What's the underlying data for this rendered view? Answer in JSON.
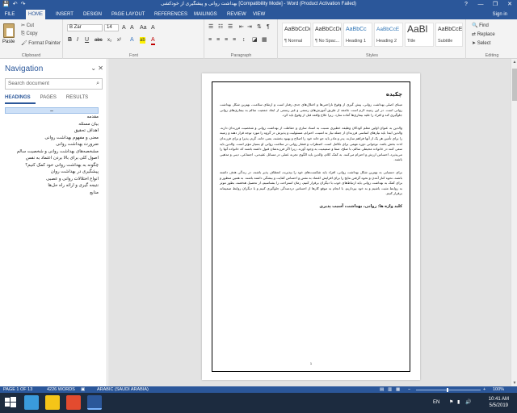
{
  "window": {
    "title": "بهداشت روانی و پیشگیری از خودکشی [Compatibility Mode] - Word (Product Activation Failed)",
    "help": "?",
    "minimize": "—",
    "maximize": "❐",
    "close": "✕"
  },
  "qat": {
    "save": "💾",
    "undo": "↶",
    "redo": "↷"
  },
  "tabs": [
    "FILE",
    "HOME",
    "INSERT",
    "DESIGN",
    "PAGE LAYOUT",
    "REFERENCES",
    "MAILINGS",
    "REVIEW",
    "VIEW"
  ],
  "signin": "Sign in",
  "ribbon": {
    "clipboard": {
      "paste": "Paste",
      "cut": "Cut",
      "copy": "Copy",
      "format_painter": "Format Painter",
      "label": "Clipboard"
    },
    "font": {
      "font_name": "B Zar",
      "font_size": "14",
      "grow": "A",
      "shrink": "A",
      "case": "Aa",
      "clear": "A",
      "bold": "B",
      "italic": "I",
      "underline": "U",
      "strike": "abc",
      "sub": "x₂",
      "sup": "x²",
      "effects": "A",
      "highlight": "ab",
      "color": "A",
      "label": "Font"
    },
    "paragraph": {
      "label": "Paragraph"
    },
    "styles": {
      "label": "Styles",
      "items": [
        {
          "sample": "AaBbCcDc",
          "name": "¶ Normal"
        },
        {
          "sample": "AaBbCcDc",
          "name": "¶ No Spac..."
        },
        {
          "sample": "AaBbCc",
          "name": "Heading 1"
        },
        {
          "sample": "AaBbCcE",
          "name": "Heading 2"
        },
        {
          "sample": "AaBl",
          "name": "Title"
        },
        {
          "sample": "AaBbCcE",
          "name": "Subtitle"
        }
      ]
    },
    "editing": {
      "find": "Find",
      "replace": "Replace",
      "select": "Select",
      "label": "Editing"
    }
  },
  "navigation": {
    "title": "Navigation",
    "search_placeholder": "Search document",
    "tabs": [
      "HEADINGS",
      "PAGES",
      "RESULTS"
    ],
    "selected_heading": "ــ",
    "headings": [
      "مقدمه",
      "بیان مسئله",
      "اهداف تحقیق",
      "معنی و مفهوم بهداشت روانی",
      "ضرورت بهداشت روانی",
      "مشخصه‌های بهداشت روانی و شخصیت سالم",
      "اصول کلی برای بالا بردن اعتماد به نفس",
      "چگونه به بهداشت روانی خود کمک کنیم؟",
      "پیشگیری در بهداشت روان",
      "انواع اختلالات روانی و عصبی",
      "نتیجه گیری و ارائه راه حل‌ها",
      "منابع"
    ]
  },
  "document": {
    "heading": "چکیده",
    "paragraphs": [
      "مبنای اصلی بهداشت روانی، پیش گیری از وقوع ناراحتی‌ها و اختلال‌های جدی رفتار است و ارتقای سلامت، بهترین شکل بهداشت روانی است. در این زمینه لازم است جامعه از طریق آموزش‌های رسمی و غیر رسمی از ابعاد جمعیت سالم به بیماری‌های روانی جلوگیری کند و افراد را علیه بیماری‌ها آماده سازد. زیرا علاج واقعه قبل از وقوع باید کرد.",
      "والدین به عنوان اولین معلم کودکان وظیفه خطیری نسبت به اسناد سازی و حفاظت از بهداشت روانی و شخصیت فرزندان دارند. والدین ابتدا باید نیازهای اساسی فرزندان از جمله نیاز به امنیت، احترام، مسئولیت و پذیرش در گروه را مورد توجه قرار دهند و زمینه را برای تأمین هر یک از آنها فراهم سازند. پدر و مادر باید جو خانه خود را اصلاح و بهبود بخشند، یعنی خانه، گرم، پذیرا و برای فرزندان لذت بخش باشد. نوجوانی دوره مهمی برای تکامل است. اضطراب و فشار روانی در سلامت روانی او بسیار مؤثر است. والدین باید سعی کنند در خانواده محیطی سالم، با صلح، صفا و صمیمیت به وجود آورند. زیرا اگر فرزندشان قبول داشته باشند که خانواده آنها را می‌پذیرد، احساس ارزش و احترام می‌کنند. به کمک کلام، والدین باید الگوی تجربه عملی در مسائل عقیدتی، اجتماعی، دینی و مذهبی باشند.",
      "برای دستیابی به بهترین شکل بهداشت روانی، افراد باید شکست‌های خود را بپذیرند، انعطاف پذیر باشند، در زندگی هدف داشته باشند، نحوه کنار آمدن و نحوه گرفتن نتایج را برای افزایش اعتماد به نفس و احساس کفایت و بیشگی داشته باشند. به همین منظور و برای کمک به بهداشت روانی باید ارتباط‌های خوب با دیگران برقرار کنیم، زمان استراحت را بشناسیم، از تحصیل هدفمند، بطور موثر به روابط مثبت باشیم و به خود بپردازیم. با انجام به موقع کارها از احساس دردمندگی جلوگیری کنیم و با دیگران روابط صمیمانه برقرار کنیم."
    ],
    "keywords": "کلید واژه ها: روانی، بهداشت، آسیب پذیری",
    "page_number": "1"
  },
  "status": {
    "page": "PAGE 1 OF 13",
    "words": "4226 WORDS",
    "language": "ARABIC (SAUDI ARABIA)",
    "zoom": "100%"
  },
  "taskbar": {
    "lang": "EN",
    "time": "10:41 AM",
    "date": "5/5/2019",
    "icon_colors": [
      "#ffffff",
      "#f5c518",
      "#3a9bdc",
      "#e34b2f",
      "#2b579a"
    ]
  }
}
